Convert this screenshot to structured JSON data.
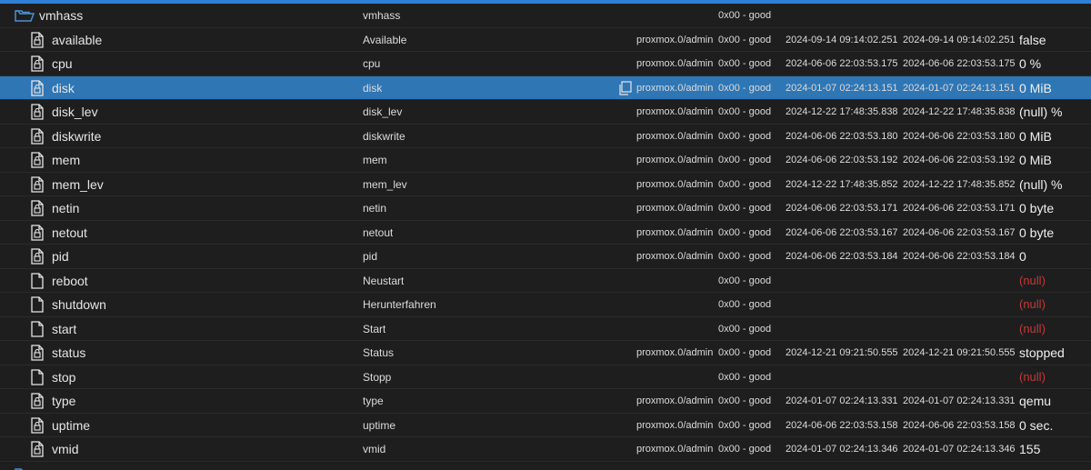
{
  "folder": {
    "name": "vmhass",
    "label": "vmhass",
    "quality": "0x00 - good",
    "icon": "folder-open-icon"
  },
  "rows": [
    {
      "id": "available",
      "name": "available",
      "label": "Available",
      "user": "proxmox.0/admin",
      "quality": "0x00 - good",
      "ts": "2024-09-14 09:14:02.251",
      "lc": "2024-09-14 09:14:02.251",
      "value": "false",
      "null": false,
      "icon": "state-file-icon"
    },
    {
      "id": "cpu",
      "name": "cpu",
      "label": "cpu",
      "user": "proxmox.0/admin",
      "quality": "0x00 - good",
      "ts": "2024-06-06 22:03:53.175",
      "lc": "2024-06-06 22:03:53.175",
      "value": "0 %",
      "null": false,
      "icon": "state-file-icon"
    },
    {
      "id": "disk",
      "name": "disk",
      "label": "disk",
      "user": "proxmox.0/admin",
      "quality": "0x00 - good",
      "ts": "2024-01-07 02:24:13.151",
      "lc": "2024-01-07 02:24:13.151",
      "value": "0 MiB",
      "null": false,
      "icon": "state-file-icon",
      "selected": true
    },
    {
      "id": "disk_lev",
      "name": "disk_lev",
      "label": "disk_lev",
      "user": "proxmox.0/admin",
      "quality": "0x00 - good",
      "ts": "2024-12-22 17:48:35.838",
      "lc": "2024-12-22 17:48:35.838",
      "value": "(null) %",
      "null": false,
      "icon": "state-file-icon"
    },
    {
      "id": "diskwrite",
      "name": "diskwrite",
      "label": "diskwrite",
      "user": "proxmox.0/admin",
      "quality": "0x00 - good",
      "ts": "2024-06-06 22:03:53.180",
      "lc": "2024-06-06 22:03:53.180",
      "value": "0 MiB",
      "null": false,
      "icon": "state-file-icon"
    },
    {
      "id": "mem",
      "name": "mem",
      "label": "mem",
      "user": "proxmox.0/admin",
      "quality": "0x00 - good",
      "ts": "2024-06-06 22:03:53.192",
      "lc": "2024-06-06 22:03:53.192",
      "value": "0 MiB",
      "null": false,
      "icon": "state-file-icon"
    },
    {
      "id": "mem_lev",
      "name": "mem_lev",
      "label": "mem_lev",
      "user": "proxmox.0/admin",
      "quality": "0x00 - good",
      "ts": "2024-12-22 17:48:35.852",
      "lc": "2024-12-22 17:48:35.852",
      "value": "(null) %",
      "null": false,
      "icon": "state-file-icon"
    },
    {
      "id": "netin",
      "name": "netin",
      "label": "netin",
      "user": "proxmox.0/admin",
      "quality": "0x00 - good",
      "ts": "2024-06-06 22:03:53.171",
      "lc": "2024-06-06 22:03:53.171",
      "value": "0 byte",
      "null": false,
      "icon": "state-file-icon"
    },
    {
      "id": "netout",
      "name": "netout",
      "label": "netout",
      "user": "proxmox.0/admin",
      "quality": "0x00 - good",
      "ts": "2024-06-06 22:03:53.167",
      "lc": "2024-06-06 22:03:53.167",
      "value": "0 byte",
      "null": false,
      "icon": "state-file-icon"
    },
    {
      "id": "pid",
      "name": "pid",
      "label": "pid",
      "user": "proxmox.0/admin",
      "quality": "0x00 - good",
      "ts": "2024-06-06 22:03:53.184",
      "lc": "2024-06-06 22:03:53.184",
      "value": "0",
      "null": false,
      "icon": "state-file-icon"
    },
    {
      "id": "reboot",
      "name": "reboot",
      "label": "Neustart",
      "user": "",
      "quality": "0x00 - good",
      "ts": "",
      "lc": "",
      "value": "(null)",
      "null": true,
      "icon": "button-file-icon"
    },
    {
      "id": "shutdown",
      "name": "shutdown",
      "label": "Herunterfahren",
      "user": "",
      "quality": "0x00 - good",
      "ts": "",
      "lc": "",
      "value": "(null)",
      "null": true,
      "icon": "button-file-icon"
    },
    {
      "id": "start",
      "name": "start",
      "label": "Start",
      "user": "",
      "quality": "0x00 - good",
      "ts": "",
      "lc": "",
      "value": "(null)",
      "null": true,
      "icon": "button-file-icon"
    },
    {
      "id": "status",
      "name": "status",
      "label": "Status",
      "user": "proxmox.0/admin",
      "quality": "0x00 - good",
      "ts": "2024-12-21 09:21:50.555",
      "lc": "2024-12-21 09:21:50.555",
      "value": "stopped",
      "null": false,
      "icon": "state-file-icon"
    },
    {
      "id": "stop",
      "name": "stop",
      "label": "Stopp",
      "user": "",
      "quality": "0x00 - good",
      "ts": "",
      "lc": "",
      "value": "(null)",
      "null": true,
      "icon": "button-file-icon"
    },
    {
      "id": "type",
      "name": "type",
      "label": "type",
      "user": "proxmox.0/admin",
      "quality": "0x00 - good",
      "ts": "2024-01-07 02:24:13.331",
      "lc": "2024-01-07 02:24:13.331",
      "value": "qemu",
      "null": false,
      "icon": "state-file-icon"
    },
    {
      "id": "uptime",
      "name": "uptime",
      "label": "uptime",
      "user": "proxmox.0/admin",
      "quality": "0x00 - good",
      "ts": "2024-06-06 22:03:53.158",
      "lc": "2024-06-06 22:03:53.158",
      "value": "0 sec.",
      "null": false,
      "icon": "state-file-icon"
    },
    {
      "id": "vmid",
      "name": "vmid",
      "label": "vmid",
      "user": "proxmox.0/admin",
      "quality": "0x00 - good",
      "ts": "2024-01-07 02:24:13.346",
      "lc": "2024-01-07 02:24:13.346",
      "value": "155",
      "null": false,
      "icon": "state-file-icon"
    }
  ],
  "selected_row_copy_icon": "copy-icon",
  "colors": {
    "accent": "#2f7fd6",
    "selected_row": "#2f76b5",
    "background": "#1e1e1e",
    "null_value": "#c23a3a"
  }
}
